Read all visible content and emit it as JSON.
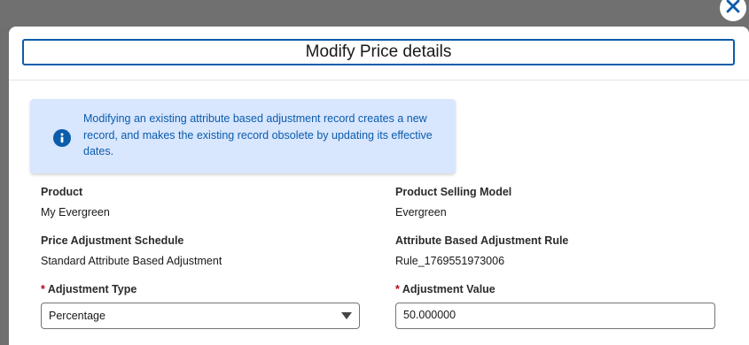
{
  "modal": {
    "title": "Modify Price details",
    "info_message": "Modifying an existing attribute based adjustment record creates a new record, and makes the existing record obsolete by updating its effective dates.",
    "icons": {
      "close": "close-icon",
      "info": "info-icon",
      "dropdown": "chevron-down-icon"
    }
  },
  "fields": {
    "product": {
      "label": "Product",
      "value": "My Evergreen"
    },
    "product_selling_model": {
      "label": "Product Selling Model",
      "value": "Evergreen"
    },
    "price_adjustment_schedule": {
      "label": "Price Adjustment Schedule",
      "value": "Standard Attribute Based Adjustment"
    },
    "attribute_based_adjustment_rule": {
      "label": "Attribute Based Adjustment Rule",
      "value": "Rule_1769551973006"
    },
    "adjustment_type": {
      "required_marker": "*",
      "label": "Adjustment Type",
      "selected": "Percentage"
    },
    "adjustment_value": {
      "required_marker": "*",
      "label": "Adjustment Value",
      "value": "50.000000"
    }
  },
  "colors": {
    "brand": "#0b5cab",
    "info_bg": "#d8e6fe",
    "required": "#ba0517"
  }
}
